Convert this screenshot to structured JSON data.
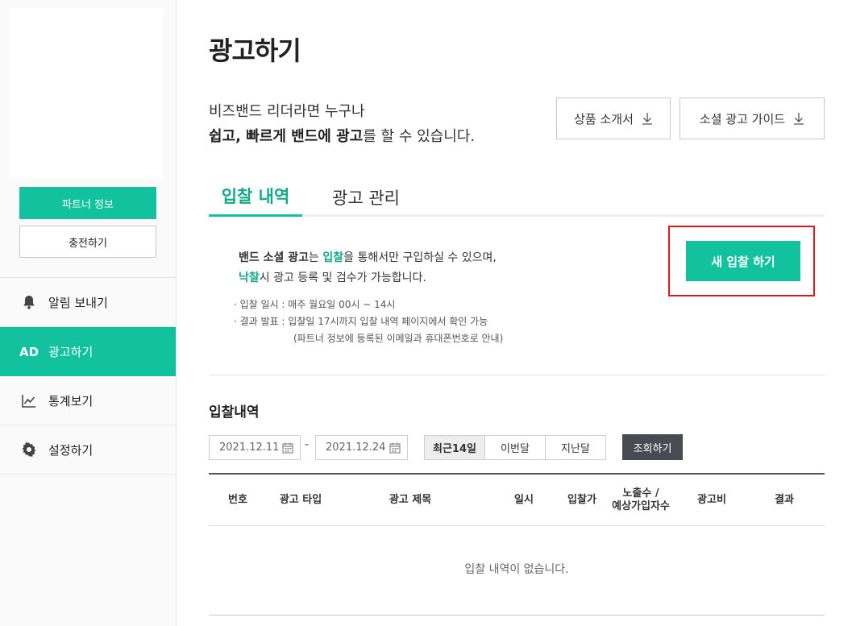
{
  "sidebar": {
    "partner_button": "파트너 정보",
    "charge_button": "충전하기",
    "menu": [
      {
        "label": "알림 보내기",
        "icon": "bell-icon"
      },
      {
        "label": "광고하기",
        "icon": "ad-icon",
        "icon_text": "AD",
        "active": true
      },
      {
        "label": "통계보기",
        "icon": "chart-icon"
      },
      {
        "label": "설정하기",
        "icon": "gear-icon"
      }
    ]
  },
  "main": {
    "title": "광고하기",
    "intro": {
      "line1": "비즈밴드 리더라면 누구나",
      "line2_bold": "쉽고, 빠르게 밴드에 광고",
      "line2_rest": "를 할 수 있습니다."
    },
    "buttons": {
      "product_intro": "상품 소개서",
      "social_guide": "소셜 광고 가이드"
    },
    "tabs": [
      {
        "label": "입찰 내역",
        "active": true
      },
      {
        "label": "광고 관리",
        "active": false
      }
    ],
    "notice": {
      "p1_bold": "밴드 소셜 광고",
      "p1_a": "는 ",
      "p1_green": "입찰",
      "p1_b": "을 통해서만 구입하실 수 있으며,",
      "p2_green": "낙찰",
      "p2_rest": "시 광고 등록 및 검수가 가능합니다.",
      "bullet1": "· 입찰 일시 : 매주 월요일 00시 ~ 14시",
      "bullet2": "· 결과 발표 : 입찰일 17시까지 입찰 내역 페이지에서 확인 가능",
      "bullet2_sub": "(파트너 정보에 등록된 이메일과 휴대폰번호로 안내)"
    },
    "new_bid_button": "새 입찰 하기",
    "history": {
      "title": "입찰내역",
      "date_start": "2021.12.11",
      "date_end": "2021.12.24",
      "separator": "-",
      "periods": [
        {
          "label": "최근14일",
          "active": true
        },
        {
          "label": "이번달",
          "active": false
        },
        {
          "label": "지난달",
          "active": false
        }
      ],
      "search_button": "조회하기",
      "columns": [
        "번호",
        "광고 타입",
        "광고 제목",
        "일시",
        "입찰가",
        "노출수 /\n예상가입자수",
        "광고비",
        "결과"
      ],
      "column_line1": "노출수 /",
      "column_line2": "예상가입자수",
      "empty_message": "입찰 내역이 없습니다."
    }
  },
  "colors": {
    "accent": "#12c29e",
    "highlight": "#e0191b",
    "dark_button": "#4a4a54"
  }
}
